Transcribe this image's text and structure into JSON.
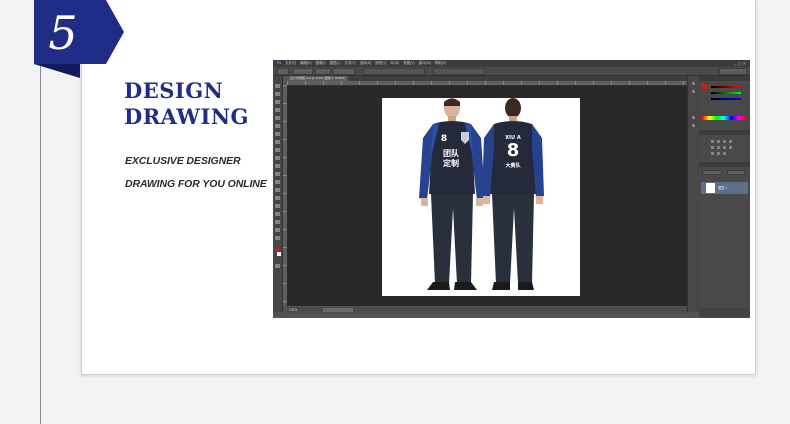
{
  "badge": {
    "number": "5",
    "color": "#1f2d86"
  },
  "title": {
    "line1": "DESIGN",
    "line2": "DRAWING",
    "color": "#1f2d86"
  },
  "subtitle": {
    "line1": "EXCLUSIVE DESIGNER",
    "line2": "DRAWING FOR YOU ONLINE"
  },
  "photoshop": {
    "menus": [
      "文件(F)",
      "编辑(E)",
      "图像(I)",
      "图层(L)",
      "文字(Y)",
      "选择(S)",
      "滤镜(T)",
      "3D(D)",
      "视图(V)",
      "窗口(W)",
      "帮助(H)"
    ],
    "window_controls": "‒ ▢ ✕",
    "tab_label": "设计效果图.psd @ 100% (图层 1, RGB/8)",
    "status_zoom": "100%",
    "layer_name": "图层 1",
    "jersey": {
      "front_number": "8",
      "front_text_line1": "团队",
      "front_text_line2": "定制",
      "back_name": "XIU A",
      "back_number": "8",
      "back_text": "大黄队"
    }
  }
}
